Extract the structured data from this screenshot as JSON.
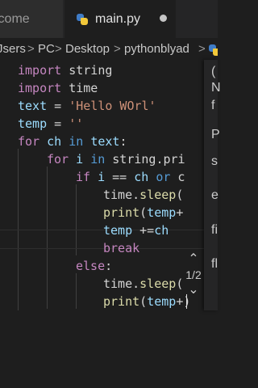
{
  "tabs": [
    {
      "label": "lcome",
      "active": false
    },
    {
      "label": "main.py",
      "active": true,
      "dirty": true
    }
  ],
  "breadcrumb": {
    "parts": [
      "Jsers",
      "PC",
      "Desktop",
      "pythonblyad"
    ],
    "separator": ">",
    "icon": "python-icon"
  },
  "code": [
    "import string",
    "import time",
    "text = 'Hello WOrl'",
    "temp = ''",
    "for ch in text:",
    "    for i in string.pri",
    "        if i == ch or c",
    "            time.sleep(",
    "            print(temp+",
    "            temp +=ch",
    "            break",
    "        else:",
    "            time.sleep(",
    "            print(temp+)"
  ],
  "signature_hint": {
    "counter": "1/2",
    "up_arrow": "chevron-up-icon",
    "down_arrow": "chevron-down-icon"
  },
  "side_panel": {
    "letters": [
      "(",
      "N",
      "f",
      "P",
      "s",
      "e",
      "fi",
      "fl"
    ]
  }
}
